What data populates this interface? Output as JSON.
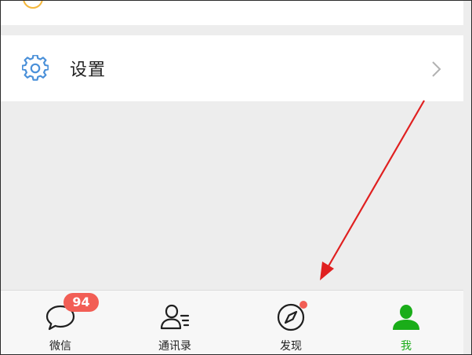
{
  "settings": {
    "label": "设置",
    "icon": "gear-icon",
    "chevron_icon": "chevron-right-icon"
  },
  "tabbar": {
    "tabs": [
      {
        "label": "微信",
        "icon": "chat-bubble-icon",
        "badge": "94"
      },
      {
        "label": "通讯录",
        "icon": "contacts-icon"
      },
      {
        "label": "发现",
        "icon": "compass-icon",
        "dot": true
      },
      {
        "label": "我",
        "icon": "person-icon",
        "active": true
      }
    ]
  },
  "colors": {
    "accent_green": "#1aad19",
    "badge_red": "#f25e55",
    "gear_blue": "#4a90d9",
    "arrow_red": "#e02020"
  }
}
